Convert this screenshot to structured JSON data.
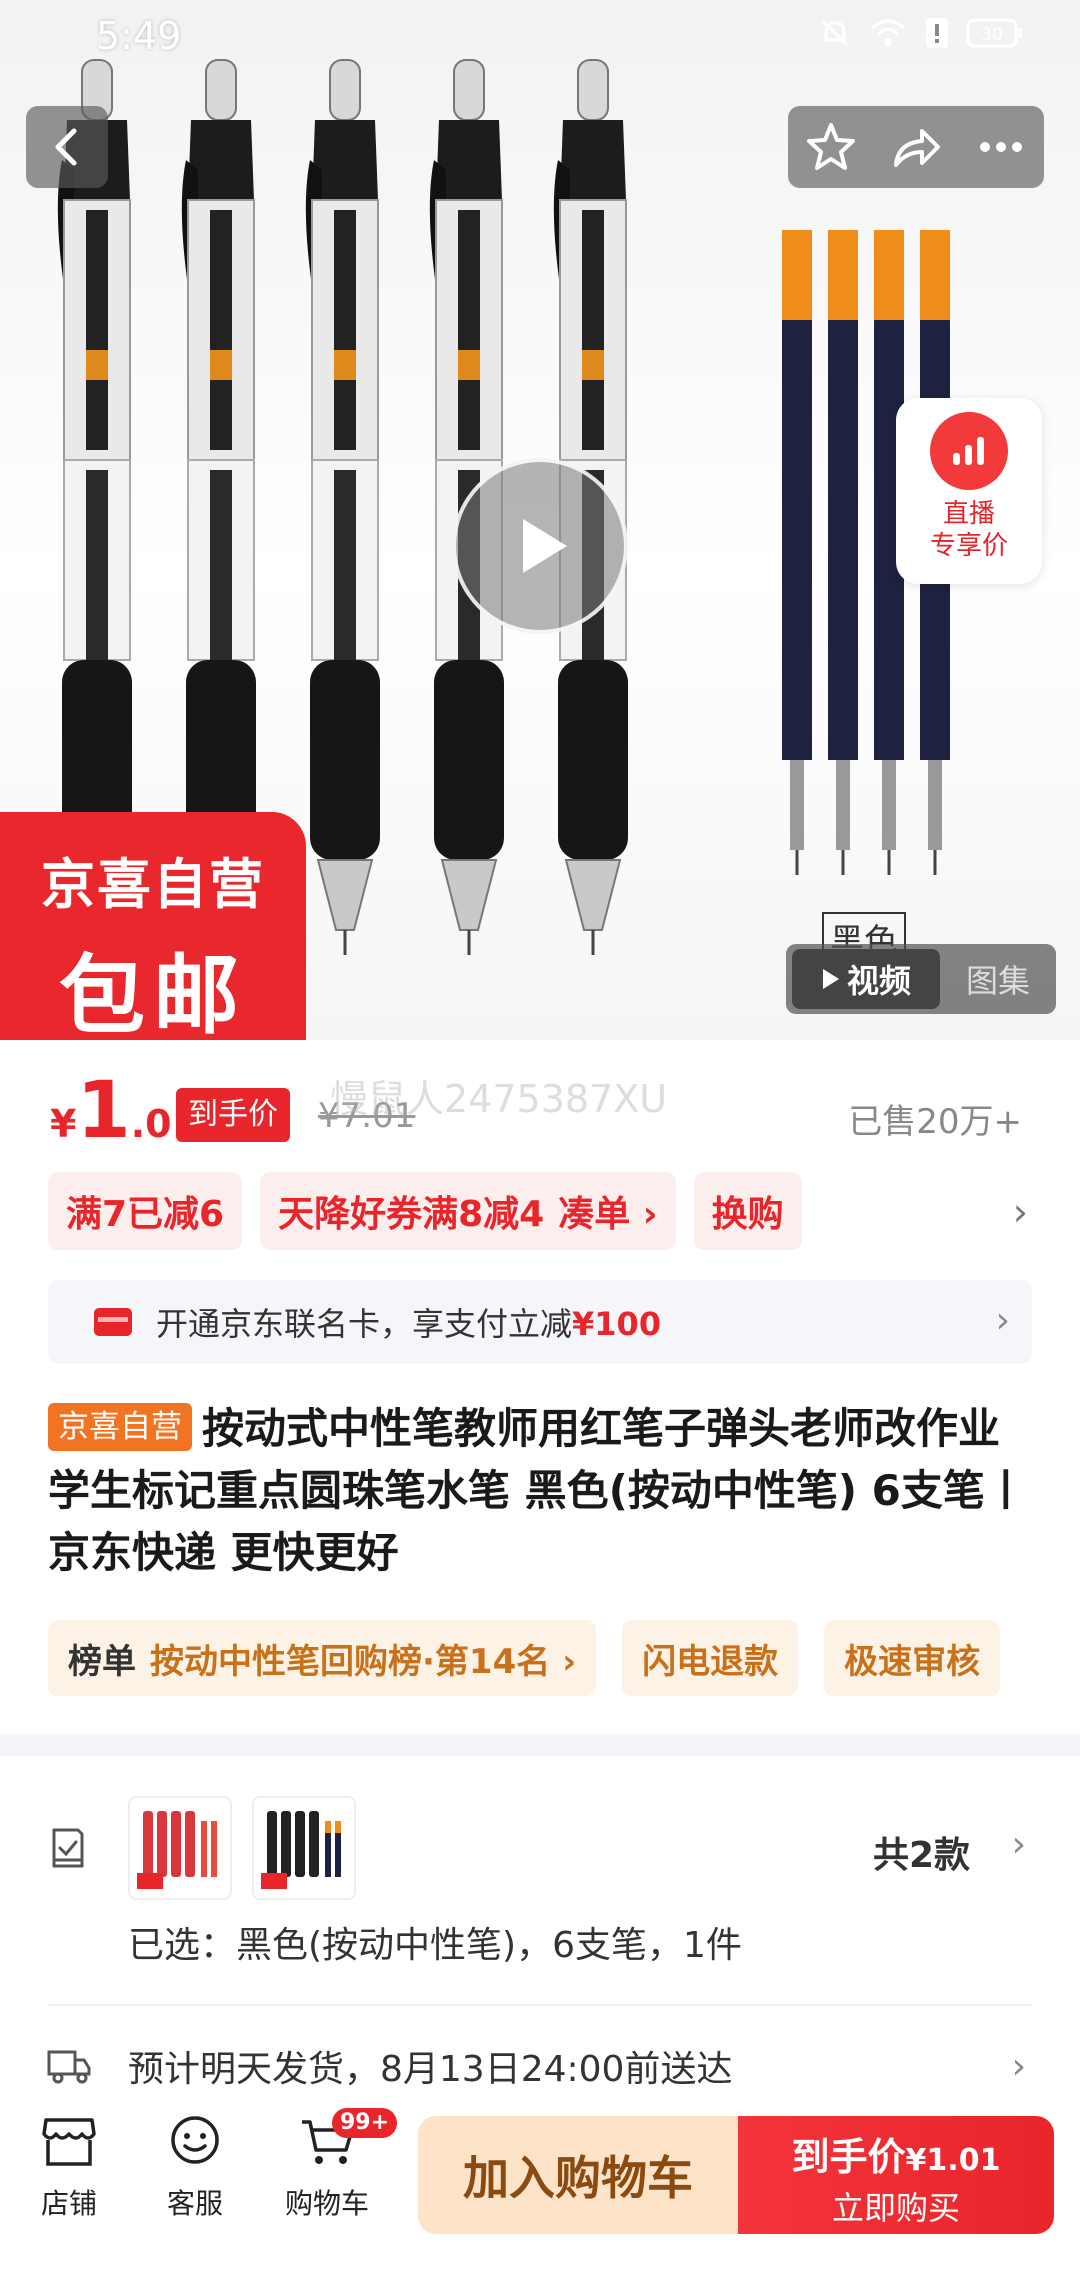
{
  "status_bar": {
    "time": "5:49",
    "battery": "30"
  },
  "hero": {
    "live_badge": {
      "line1": "直播",
      "line2": "专享价"
    },
    "jingxi_badge": {
      "line1": "京喜自营",
      "line2": "包邮"
    },
    "color_label": "黑色",
    "media_tabs": {
      "active": "视频",
      "inactive": "图集"
    }
  },
  "price": {
    "symbol": "¥",
    "integer": "1",
    "decimal": ".01",
    "tag": "到手价",
    "original": "¥7.01",
    "watermark": "慢鼠人2475387XU",
    "sold": "已售20万+"
  },
  "promos": [
    {
      "label": "满7已减6"
    },
    {
      "label": "天降好券满8减4"
    },
    {
      "label": "凑单 ›"
    },
    {
      "label": "换购"
    }
  ],
  "card_banner": {
    "text": "开通京东联名卡，享支付立减",
    "highlight": "¥100"
  },
  "title": {
    "tag": "京喜自营",
    "text": "按动式中性笔教师用红笔子弹头老师改作业学生标记重点圆珠笔水笔 黑色(按动中性笔) 6支笔丨京东快递 更快更好"
  },
  "rank_chips": [
    {
      "label": "榜单",
      "text": "按动中性笔回购榜·第14名 ›"
    },
    {
      "label": "",
      "text": "闪电退款"
    },
    {
      "label": "",
      "text": "极速审核"
    }
  ],
  "selection": {
    "count": "共2款",
    "selected": "已选：黑色(按动中性笔)，6支笔，1件"
  },
  "shipping": {
    "text": "预计明天发货，8月13日24:00前送达"
  },
  "bottom_bar": {
    "shop": "店铺",
    "service": "客服",
    "cart": "购物车",
    "cart_badge": "99+",
    "add_cart": "加入购物车",
    "buy_line1": "到手价",
    "buy_price": "¥1.01",
    "buy_line2": "立即购买"
  },
  "colors": {
    "accent": "#e8252b",
    "orange": "#f27321",
    "rank_text": "#c8711a"
  }
}
